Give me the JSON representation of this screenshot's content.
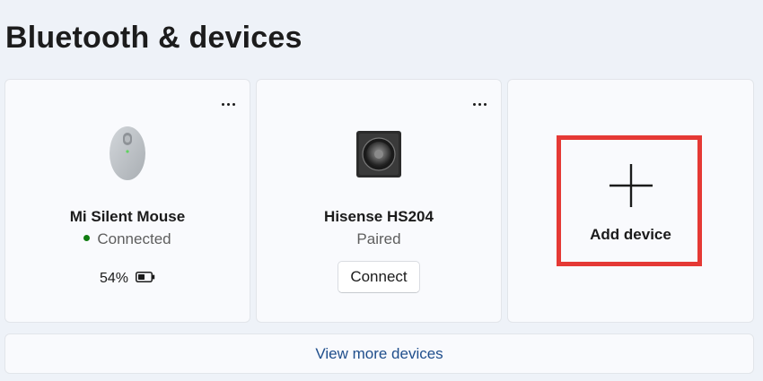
{
  "page": {
    "title": "Bluetooth & devices"
  },
  "devices": [
    {
      "name": "Mi Silent Mouse",
      "status": "Connected",
      "status_color": "#107c10",
      "battery": "54%",
      "battery_level": 0.54,
      "icon": "mouse-icon"
    },
    {
      "name": "Hisense HS204",
      "status": "Paired",
      "action_label": "Connect",
      "icon": "speaker-icon"
    }
  ],
  "add_device": {
    "label": "Add device",
    "icon": "plus-icon",
    "highlight_color": "#e53935"
  },
  "view_more": {
    "label": "View more devices",
    "color": "#1f4e8c"
  }
}
